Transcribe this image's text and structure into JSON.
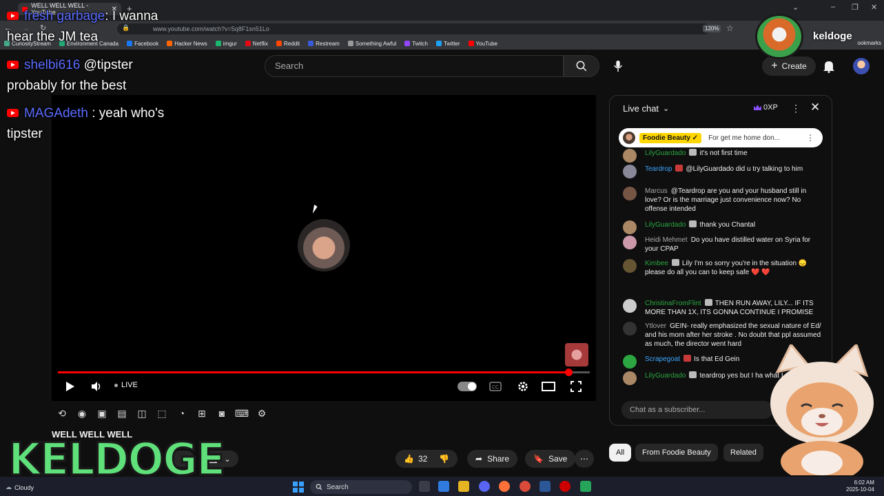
{
  "browser": {
    "tab_title": "WELL WELL WELL - YouTube",
    "url": "www.youtube.com/watch?v=5q8F1sn51Lo",
    "zoom": "120%",
    "bookmarks": [
      "CuriosityStream",
      "Environment Canada",
      "Facebook",
      "Hacker News",
      "imgur",
      "Netflix",
      "Reddit",
      "Restream",
      "Something Awful",
      "Twitch",
      "Twitter",
      "YouTube"
    ],
    "bookmarks_right": "ookmarks"
  },
  "yt": {
    "search_placeholder": "Search",
    "create_label": "Create"
  },
  "overlay_chat": [
    {
      "user": "fresh garbage",
      "sep": ":",
      "text": "I wanna"
    },
    {
      "text": "hear the JM tea"
    },
    {
      "user": "shelbi616",
      "text": "@tipster"
    },
    {
      "text": "probably for the best"
    },
    {
      "user": "MAGAdeth",
      "sep": ":",
      "text": "yeah who's"
    },
    {
      "text": "tipster"
    }
  ],
  "player": {
    "live_label": "LIVE"
  },
  "video": {
    "title": "WELL WELL WELL",
    "sub_label": "n",
    "likes": "32",
    "share_label": "Share",
    "save_label": "Save"
  },
  "logo_text": "KELDOGE",
  "streamer_name": "keldoge",
  "chat": {
    "header": "Live chat",
    "xp": "0XP",
    "pinned_user": "Foodie Beauty ✓",
    "pinned_text": "For get me home don...",
    "messages": [
      {
        "user": "LilyGuardado",
        "text": "it's not first time",
        "color": "green"
      },
      {
        "user": "Teardrop",
        "text": "@LilyGuardado did u try talking to him",
        "color": "blue"
      },
      {
        "user": "Marcus",
        "text": "@Teardrop are you and your husband still in love? Or is the marriage just convenience now? No offense intended",
        "color": "gray"
      },
      {
        "user": "LilyGuardado",
        "text": "thank you Chantal",
        "color": "green"
      },
      {
        "user": "Heidi Mehmet",
        "text": "Do you have distilled water on Syria for your CPAP",
        "color": "gray"
      },
      {
        "user": "Kimbee",
        "text": "Lily I'm so sorry you're in the situation 😞 please do all you can to keep safe ❤️ ❤️",
        "color": "green"
      },
      {
        "user": "ChristinaFromFlint",
        "text": "THEN RUN AWAY, LILY... IF ITS MORE THAN 1X, ITS GONNA CONTINUE I PROMISE",
        "color": "green"
      },
      {
        "user": "Ytlover",
        "text": "GEIN- really emphasized the sexual nature of Ed/ and his mom after her stroke . No doubt that ppl assumed as much, the director went hard",
        "color": "gray"
      },
      {
        "user": "Scrapegoat",
        "text": "Is that Ed Gein",
        "color": "blue"
      },
      {
        "user": "LilyGuardado",
        "text": "teardrop yes but I ha what I say",
        "color": "green"
      }
    ],
    "input_placeholder": "Chat as a subscriber..."
  },
  "chips": [
    "All",
    "From Foodie Beauty",
    "Related"
  ],
  "taskbar": {
    "weather": "Cloudy",
    "search": "Search",
    "time": "6:02 AM",
    "date": "2025-10-04"
  }
}
